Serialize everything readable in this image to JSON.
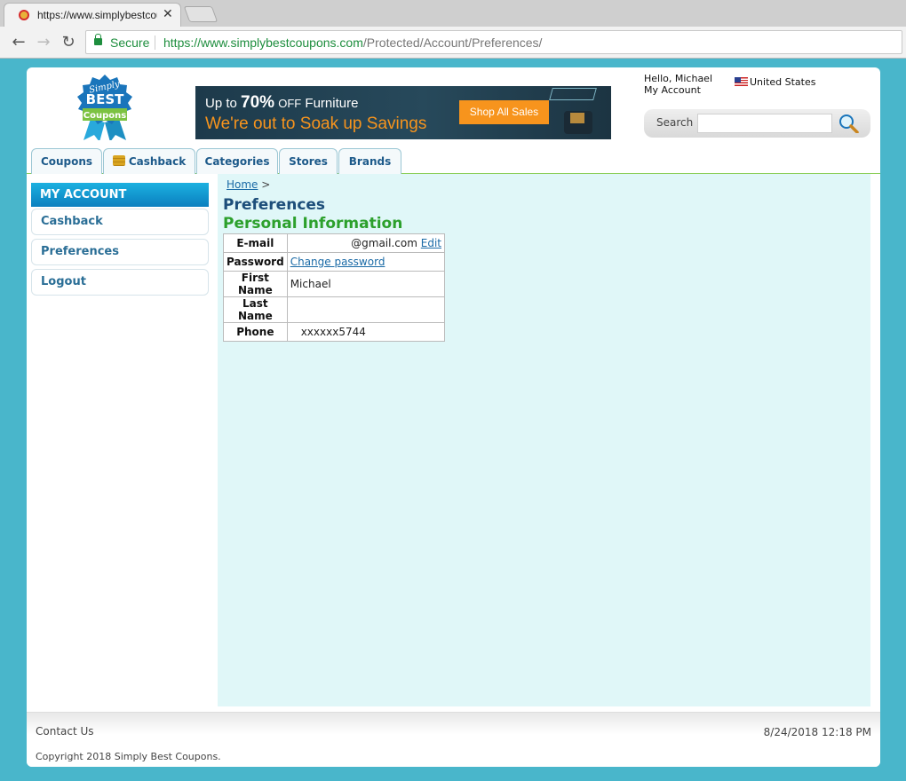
{
  "browser": {
    "tab_title": "https://www.simplybestcoupons.com/Protected/Account/Preferences/",
    "secure_label": "Secure",
    "url_scheme": "https://",
    "url_host": "www.simplybestcoupons.com",
    "url_path": "/Protected/Account/Preferences/"
  },
  "header": {
    "logo_text_top": "Simply",
    "logo_text_mid": "BEST",
    "logo_text_bottom": "Coupons",
    "hello": "Hello, Michael",
    "my_account": "My Account",
    "country": "United States",
    "search_label": "Search",
    "search_value": ""
  },
  "banner": {
    "up_to": "Up  to",
    "percent": "70%",
    "off": "OFF",
    "category": "Furniture",
    "tagline": "We're out to Soak up Savings",
    "cta": "Shop All Sales"
  },
  "nav_tabs": [
    "Coupons",
    "Cashback",
    "Categories",
    "Stores",
    "Brands"
  ],
  "sidebar": {
    "heading": "MY ACCOUNT",
    "items": [
      "Cashback",
      "Preferences",
      "Logout"
    ]
  },
  "content": {
    "breadcrumb_home": "Home",
    "breadcrumb_sep": ">",
    "title": "Preferences",
    "section_title": "Personal Information",
    "rows": [
      {
        "label": "E-mail",
        "value": "@gmail.com",
        "link": "Edit"
      },
      {
        "label": "Password",
        "value": "",
        "link": "Change password"
      },
      {
        "label": "First Name",
        "value": "Michael",
        "link": ""
      },
      {
        "label": "Last Name",
        "value": "",
        "link": ""
      },
      {
        "label": "Phone",
        "value": "xxxxxx5744",
        "link": ""
      }
    ]
  },
  "footer": {
    "contact": "Contact Us",
    "timestamp": "8/24/2018 12:18 PM",
    "copyright": "Copyright 2018 Simply Best Coupons."
  },
  "colors": {
    "page_bg": "#49b6cb",
    "accent_blue": "#1d5a8a",
    "accent_green": "#2ca02c",
    "content_bg": "#e0f7f8",
    "banner_orange": "#f7941d"
  }
}
